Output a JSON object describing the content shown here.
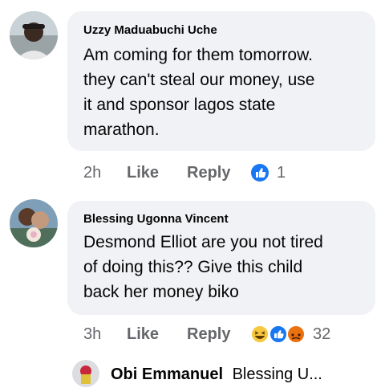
{
  "comments": [
    {
      "author": "Uzzy Maduabuchi Uche",
      "text": "Am coming for them tomorrow.\nthey can't steal our money,  use\nit and sponsor lagos state\nmarathon.",
      "time": "2h",
      "like_label": "Like",
      "reply_label": "Reply",
      "reactions": [
        "like-icon"
      ],
      "reaction_count": "1"
    },
    {
      "author": "Blessing Ugonna Vincent",
      "text": "Desmond Elliot are you not tired\nof doing this?? Give this child\nback her money biko",
      "time": "3h",
      "like_label": "Like",
      "reply_label": "Reply",
      "reactions": [
        "haha-icon",
        "like-icon",
        "angry-icon"
      ],
      "reaction_count": "32"
    }
  ],
  "reply_preview": {
    "author": "Obi Emmanuel",
    "snippet": "Blessing U..."
  },
  "colors": {
    "bubble": "#f0f2f5",
    "meta_text": "#65676b",
    "like_blue": "#1877f2",
    "haha_yellow": "#f7c740",
    "angry_red": "#e9710f"
  }
}
